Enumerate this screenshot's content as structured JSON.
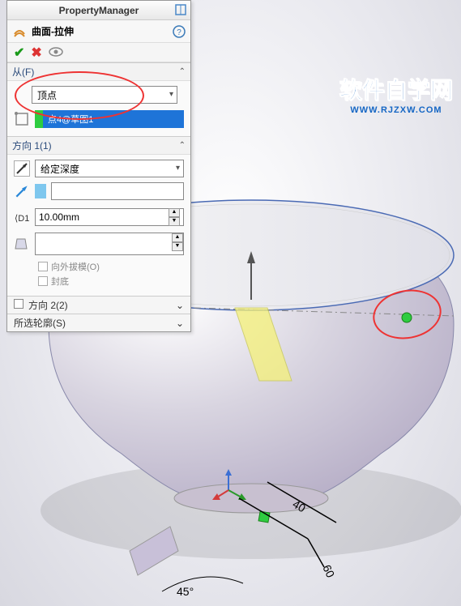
{
  "panel": {
    "title": "PropertyManager",
    "feature_name": "曲面-拉伸",
    "from": {
      "header": "从(F)",
      "dropdown": "顶点",
      "selection": "点4@草图1"
    },
    "dir1": {
      "header": "方向 1(1)",
      "end_condition": "给定深度",
      "depth": "10.00mm",
      "draft_outward": "向外拔模(O)",
      "cap": "封底"
    },
    "dir2_header": "方向 2(2)",
    "contour_header": "所选轮廓(S)"
  },
  "watermark": {
    "main": "软件自学网",
    "sub": "WWW.RJZXW.COM"
  },
  "dims": {
    "d1": "40",
    "d2": "60",
    "angle": "45°"
  }
}
